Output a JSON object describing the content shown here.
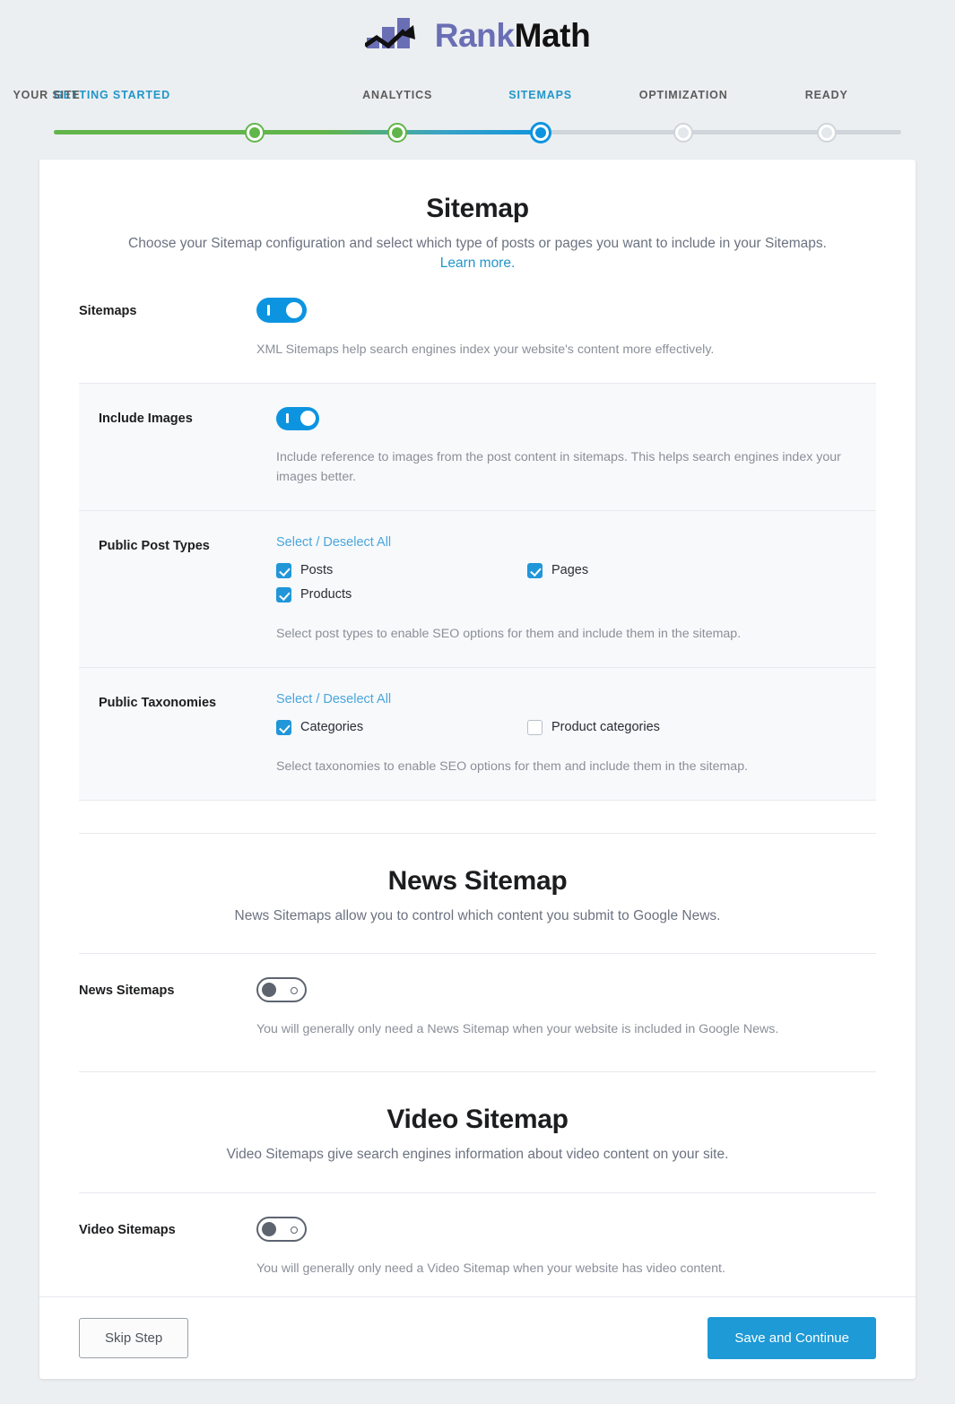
{
  "brand": {
    "name_part1": "Rank",
    "name_part2": "Math",
    "color_primary": "#6a6fb5",
    "color_secondary": "#121212"
  },
  "stepper": {
    "steps": [
      {
        "label": "GETTING STARTED",
        "state": "done"
      },
      {
        "label": "YOUR SITE",
        "state": "done"
      },
      {
        "label": "ANALYTICS",
        "state": "done"
      },
      {
        "label": "SITEMAPS",
        "state": "active"
      },
      {
        "label": "OPTIMIZATION",
        "state": "todo"
      },
      {
        "label": "READY",
        "state": "todo"
      }
    ],
    "colors": {
      "done": "#62b54a",
      "active": "#0d94e0",
      "todo": "#cfd5da",
      "active_text": "#2196c9"
    }
  },
  "sitemap": {
    "title": "Sitemap",
    "subtitle": "Choose your Sitemap configuration and select which type of posts or pages you want to include in your Sitemaps.",
    "learn_more": "Learn more.",
    "sitemaps_row": {
      "label": "Sitemaps",
      "toggle_state": "on",
      "description": "XML Sitemaps help search engines index your website's content more effectively."
    },
    "include_images": {
      "label": "Include Images",
      "toggle_state": "on",
      "description": "Include reference to images from the post content in sitemaps. This helps search engines index your images better."
    },
    "public_post_types": {
      "label": "Public Post Types",
      "select_all": "Select / Deselect All",
      "options": [
        {
          "label": "Posts",
          "checked": true
        },
        {
          "label": "Pages",
          "checked": true
        },
        {
          "label": "Products",
          "checked": true
        }
      ],
      "description": "Select post types to enable SEO options for them and include them in the sitemap."
    },
    "public_taxonomies": {
      "label": "Public Taxonomies",
      "select_all": "Select / Deselect All",
      "options": [
        {
          "label": "Categories",
          "checked": true
        },
        {
          "label": "Product categories",
          "checked": false
        }
      ],
      "description": "Select taxonomies to enable SEO options for them and include them in the sitemap."
    }
  },
  "news_sitemap": {
    "title": "News Sitemap",
    "subtitle": "News Sitemaps allow you to control which content you submit to Google News.",
    "row": {
      "label": "News Sitemaps",
      "toggle_state": "off",
      "description": "You will generally only need a News Sitemap when your website is included in Google News."
    }
  },
  "video_sitemap": {
    "title": "Video Sitemap",
    "subtitle": "Video Sitemaps give search engines information about video content on your site.",
    "row": {
      "label": "Video Sitemaps",
      "toggle_state": "off",
      "description": "You will generally only need a Video Sitemap when your website has video content."
    }
  },
  "footer": {
    "skip_label": "Skip Step",
    "save_label": "Save and Continue",
    "save_color": "#1e9ad6"
  }
}
